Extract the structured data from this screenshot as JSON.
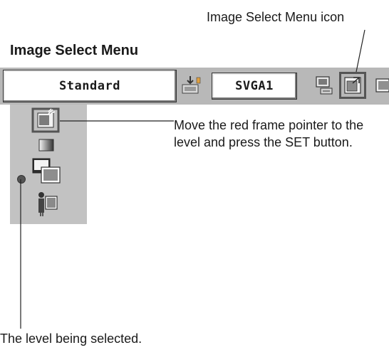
{
  "callouts": {
    "menu_icon": "Image Select Menu icon",
    "level_selected": "The level being selected."
  },
  "heading": "Image Select Menu",
  "menubar": {
    "field_primary": "Standard",
    "field_secondary": "SVGA1",
    "icons": [
      "input-icon",
      "system-icon",
      "image-select-icon",
      "next-menu-icon"
    ]
  },
  "level_panel": {
    "icons": [
      "level-pointer-icon",
      "level-gradient-icon",
      "level-overlay-icon",
      "level-person-icon"
    ],
    "selected_index": 2
  },
  "description": "Move the red frame pointer to the level and press the SET button.",
  "colors": {
    "menubar": "#b8b8b8",
    "panel": "#c2c2c2",
    "frame": "#555555"
  }
}
